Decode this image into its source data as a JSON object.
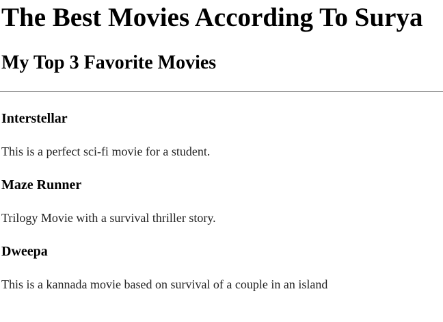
{
  "page": {
    "title": "The Best Movies According To Surya",
    "subtitle": "My Top 3 Favorite Movies"
  },
  "movies": [
    {
      "title": "Interstellar",
      "description": "This is a perfect sci-fi movie for a student."
    },
    {
      "title": "Maze Runner",
      "description": "Trilogy Movie with a survival thriller story."
    },
    {
      "title": "Dweepa",
      "description": "This is a kannada movie based on survival of a couple in an island"
    }
  ]
}
